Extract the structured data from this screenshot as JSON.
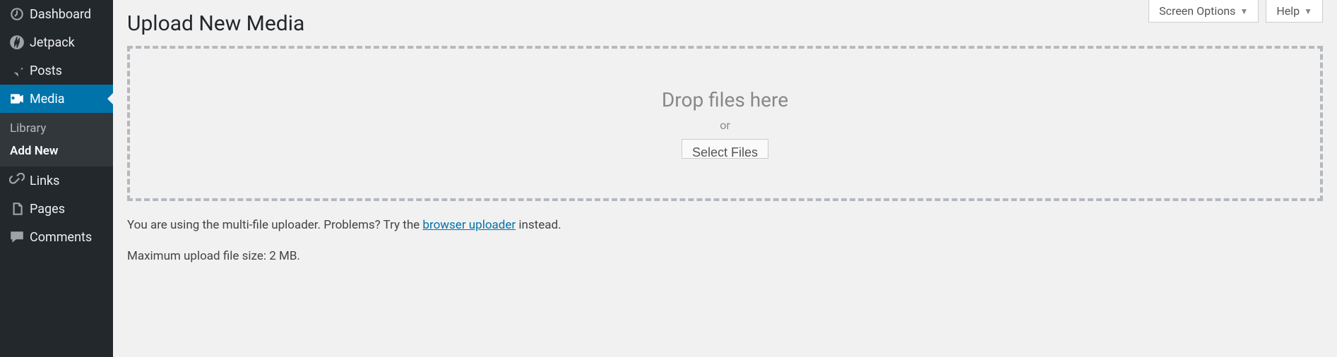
{
  "sidebar": {
    "items": [
      {
        "label": "Dashboard"
      },
      {
        "label": "Jetpack"
      },
      {
        "label": "Posts"
      },
      {
        "label": "Media"
      },
      {
        "label": "Links"
      },
      {
        "label": "Pages"
      },
      {
        "label": "Comments"
      }
    ],
    "submenu": {
      "library": "Library",
      "addnew": "Add New"
    }
  },
  "topTabs": {
    "screenOptions": "Screen Options",
    "help": "Help"
  },
  "page": {
    "title": "Upload New Media",
    "dropText": "Drop files here",
    "orText": "or",
    "selectFiles": "Select Files",
    "uploaderNotice_pre": "You are using the multi-file uploader. Problems? Try the ",
    "uploaderNotice_link": "browser uploader",
    "uploaderNotice_post": " instead.",
    "maxSize": "Maximum upload file size: 2 MB."
  }
}
